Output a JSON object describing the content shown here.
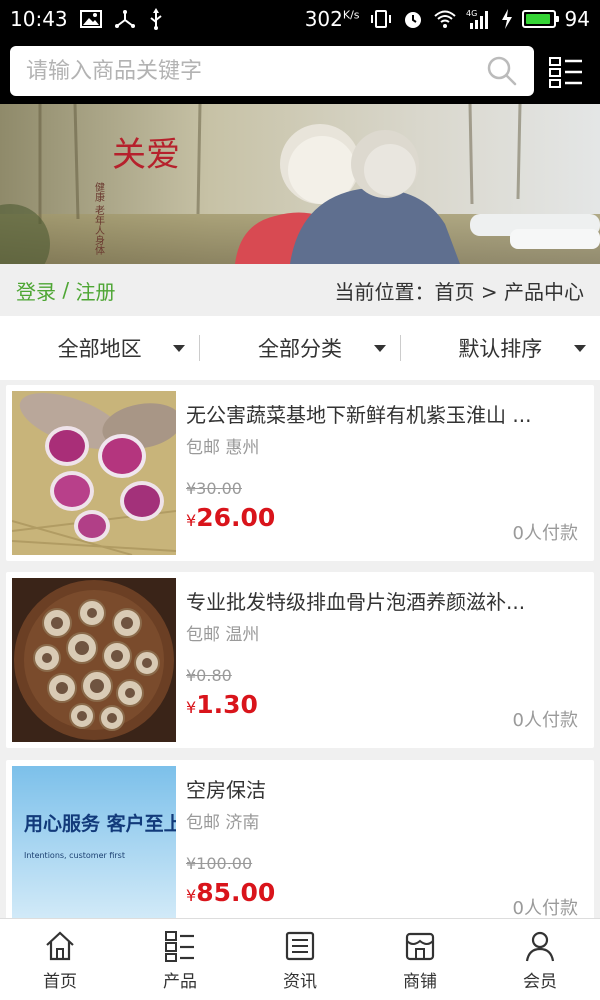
{
  "status_bar": {
    "time": "10:43",
    "net_speed": "302",
    "net_unit": "K/s",
    "battery": "94",
    "battery_level": 0.94,
    "icons": [
      "image-icon",
      "usb-share-icon",
      "usb-icon",
      "vibrate-icon",
      "alarm-icon",
      "wifi-icon",
      "signal-4g-icon",
      "charging-icon",
      "battery-icon"
    ]
  },
  "search": {
    "placeholder": "请输入商品关键字",
    "value": ""
  },
  "banner": {
    "title": "关爱",
    "subtitle": "健康 老年人身体"
  },
  "nav": {
    "login": "登录",
    "separator": " / ",
    "register": "注册",
    "breadcrumb": "当前位置：首页 > 产品中心"
  },
  "filters": [
    {
      "label": "全部地区"
    },
    {
      "label": "全部分类"
    },
    {
      "label": "默认排序"
    }
  ],
  "products": [
    {
      "title": "无公害蔬菜基地下新鲜有机紫玉淮山 ...",
      "shipping": "包邮  惠州",
      "old_price": "¥30.00",
      "currency": "¥",
      "price": "26.00",
      "sold": "0人付款"
    },
    {
      "title": "专业批发特级排血骨片泡酒养颜滋补...",
      "shipping": "包邮  温州",
      "old_price": "¥0.80",
      "currency": "¥",
      "price": "1.30",
      "sold": "0人付款"
    },
    {
      "title": "空房保洁",
      "shipping": "包邮  济南",
      "old_price": "¥100.00",
      "currency": "¥",
      "price": "85.00",
      "sold": "0人付款",
      "image_text": "用心服务  客户至上",
      "image_subtext": "Intentions, customer first"
    }
  ],
  "tabs": [
    {
      "label": "首页",
      "icon": "home-icon"
    },
    {
      "label": "产品",
      "icon": "product-list-icon"
    },
    {
      "label": "资讯",
      "icon": "news-icon"
    },
    {
      "label": "商铺",
      "icon": "store-icon"
    },
    {
      "label": "会员",
      "icon": "member-icon"
    }
  ],
  "colors": {
    "accent_green": "#4ea634",
    "price_red": "#d9141b",
    "header_bg": "#000000"
  }
}
